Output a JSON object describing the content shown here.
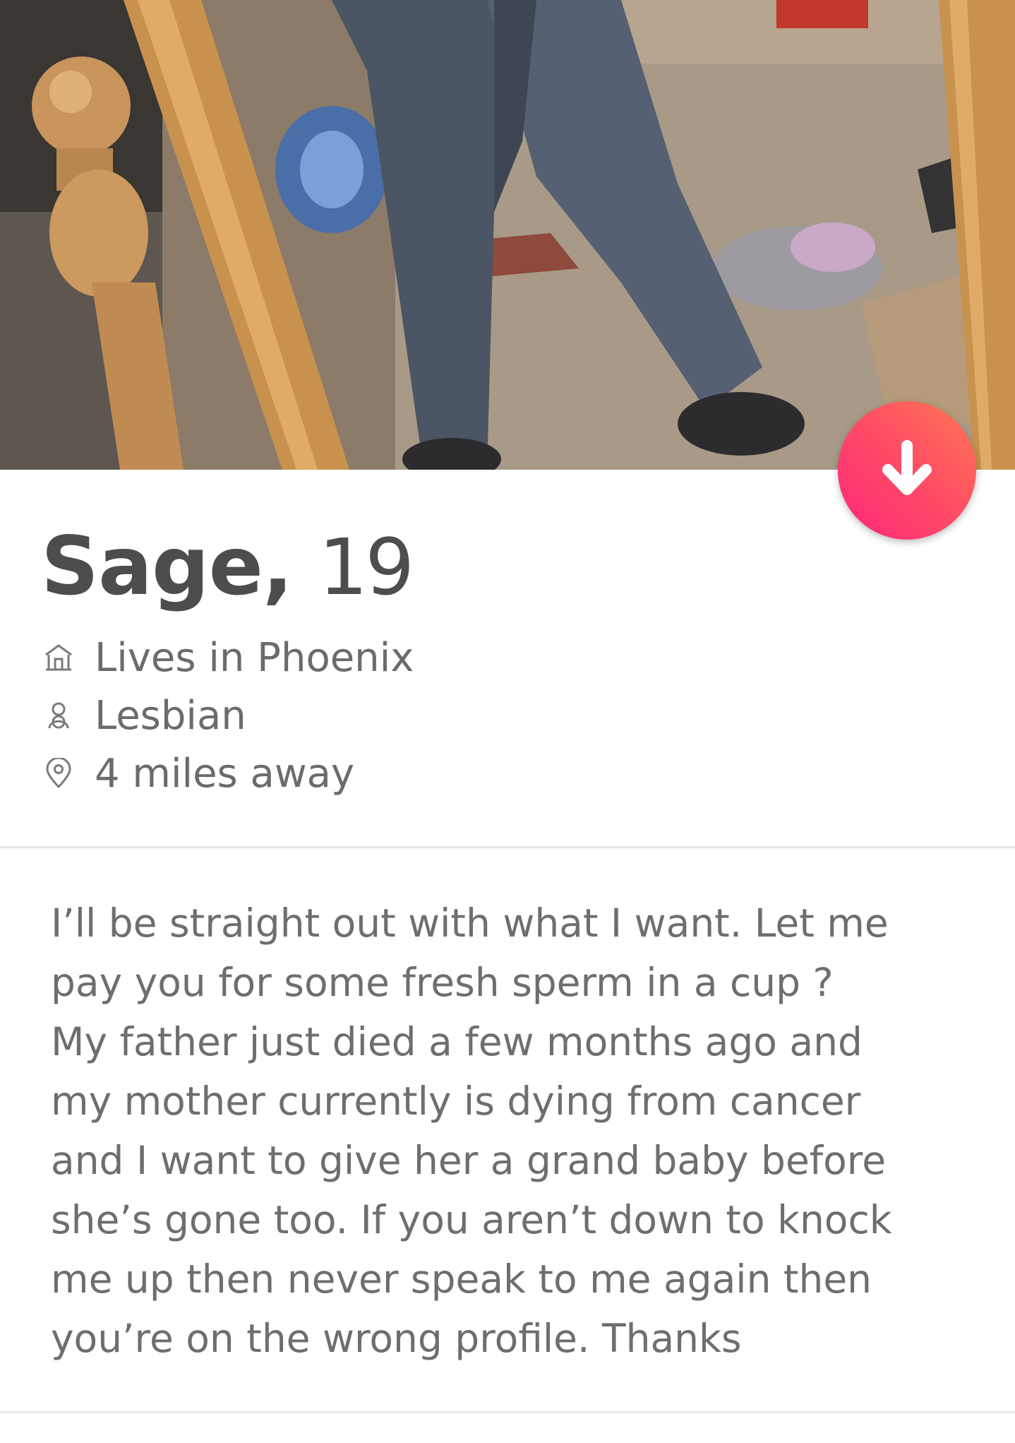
{
  "profile": {
    "name": "Sage",
    "comma": ",",
    "age": "19",
    "info": [
      {
        "icon": "home-icon",
        "text": "Lives in Phoenix"
      },
      {
        "icon": "person-icon",
        "text": "Lesbian"
      },
      {
        "icon": "location-pin-icon",
        "text": "4 miles away"
      }
    ],
    "bio_lines": [
      "I’ll be straight out with what I want. Let me",
      "pay you for some fresh sperm in a cup ?",
      "My father just died a few months ago and",
      "my mother currently is dying from cancer",
      "and I want to give her a grand baby before",
      "she’s gone too. If you aren’t down to knock",
      "me up then never speak to me again then",
      "you’re on the wrong profile. Thanks"
    ]
  },
  "collapse_button": {
    "icon": "arrow-down-icon"
  },
  "colors": {
    "accent_start": "#fd267a",
    "accent_end": "#ff7854",
    "name_text": "#4d4d4d",
    "info_text": "#6b6b6b",
    "bio_text": "#6e6e6e",
    "divider": "#e7e7e7"
  }
}
